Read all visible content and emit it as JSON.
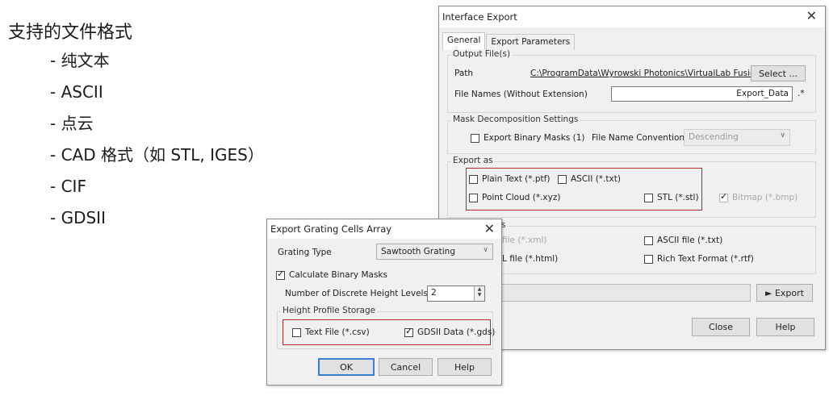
{
  "slide": {
    "title": "支持的文件格式",
    "items": [
      "-  纯文本",
      "- ASCII",
      "-  点云",
      "- CAD 格式（如 STL, IGES）",
      "- CIF",
      "- GDSII"
    ]
  },
  "interface_export": {
    "title": "Interface Export",
    "tabs": [
      "General",
      "Export Parameters"
    ],
    "output_files": {
      "group_title": "Output File(s)",
      "path_label": "Path",
      "path_value": "C:\\ProgramData\\Wyrowski Photonics\\VirtualLab Fusion\\",
      "select_button": "Select ...",
      "filename_label": "File Names (Without Extension)",
      "filename_value": "Export_Data",
      "ext_suffix": ".*"
    },
    "mask": {
      "group_title": "Mask Decomposition Settings",
      "export_binary_masks": "Export Binary Masks (1)",
      "file_name_convention_label": "File Name Convention",
      "file_name_convention_value": "Descending"
    },
    "export_as": {
      "group_title": "Export as",
      "plain_text": "Plain Text (*.ptf)",
      "ascii": "ASCII (*.txt)",
      "point_cloud": "Point Cloud (*.xyz)",
      "stl": "STL (*.stl)",
      "bitmap": "Bitmap (*.bmp)"
    },
    "other": {
      "partial_title": "s",
      "xml_partial": "file (*.xml)",
      "html_partial": "L file (*.html)",
      "ascii_file": "ASCII file (*.txt)",
      "rtf": "Rich Text Format (*.rtf)"
    },
    "export_button": "► Export",
    "close_button": "Close",
    "help_button": "Help"
  },
  "grating_export": {
    "title": "Export Grating Cells Array",
    "grating_type_label": "Grating Type",
    "grating_type_value": "Sawtooth Grating",
    "calculate_binary_masks": "Calculate Binary Masks",
    "levels_label": "Number of Discrete Height Levels",
    "levels_value": "2",
    "storage": {
      "group_title": "Height Profile Storage",
      "text_file": "Text File (*.csv)",
      "gdsii": "GDSII Data (*.gds)"
    },
    "ok_button": "OK",
    "cancel_button": "Cancel",
    "help_button": "Help"
  }
}
